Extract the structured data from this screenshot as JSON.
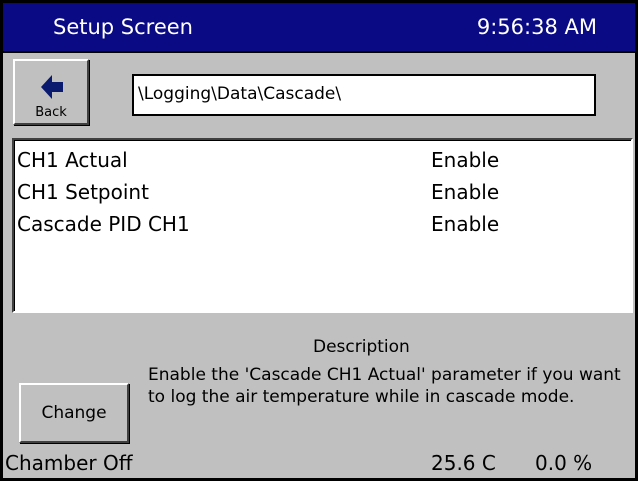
{
  "header": {
    "title": "Setup Screen",
    "time": "9:56:38 AM",
    "background_color": "#0a0a84"
  },
  "toolbar": {
    "back_label": "Back",
    "back_icon": "left-arrow-icon",
    "path": "\\Logging\\Data\\Cascade\\"
  },
  "parameters": [
    {
      "name": "CH1 Actual",
      "state": "Enable"
    },
    {
      "name": "CH1 Setpoint",
      "state": "Enable"
    },
    {
      "name": "Cascade PID CH1",
      "state": "Enable"
    }
  ],
  "description": {
    "heading": "Description",
    "text": "Enable the 'Cascade CH1 Actual' parameter if you want to log the air temperature while in cascade mode."
  },
  "change_label": "Change",
  "status": {
    "chamber": "Chamber Off",
    "temperature": "25.6 C",
    "output": "0.0 %"
  }
}
